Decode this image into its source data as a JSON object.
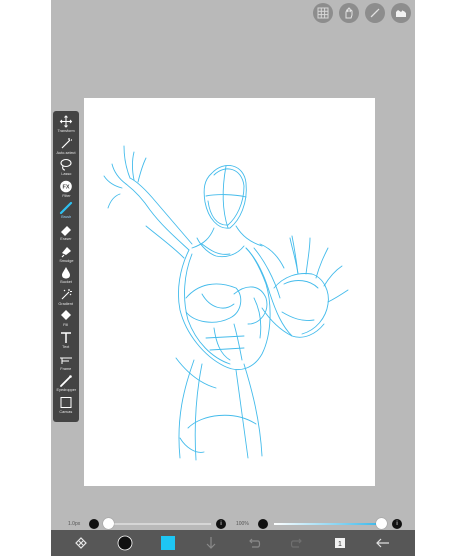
{
  "top_tools": [
    {
      "name": "layer-grid-icon"
    },
    {
      "name": "hand-icon"
    },
    {
      "name": "ruler-icon"
    },
    {
      "name": "material-icon"
    }
  ],
  "toolbar": {
    "tools": [
      {
        "name": "tool-transform",
        "icon": "move-icon",
        "label": "Transform"
      },
      {
        "name": "tool-auto-select",
        "icon": "magic-wand-icon",
        "label": "Auto-select"
      },
      {
        "name": "tool-lasso",
        "icon": "lasso-icon",
        "label": "Lasso"
      },
      {
        "name": "tool-filter",
        "icon": "fx-icon",
        "label": "Filter"
      },
      {
        "name": "tool-brush",
        "icon": "brush-icon",
        "label": "Brush"
      },
      {
        "name": "tool-eraser",
        "icon": "eraser-icon",
        "label": "Eraser"
      },
      {
        "name": "tool-smudge",
        "icon": "smudge-icon",
        "label": "Smudge"
      },
      {
        "name": "tool-bucket",
        "icon": "droplet-icon",
        "label": "Bucket"
      },
      {
        "name": "tool-gradient",
        "icon": "sparkle-wand-icon",
        "label": "Gradient"
      },
      {
        "name": "tool-fill",
        "icon": "fill-icon",
        "label": "Fill"
      },
      {
        "name": "tool-text",
        "icon": "text-icon",
        "label": "Text"
      },
      {
        "name": "tool-frame",
        "icon": "frame-icon",
        "label": "Frame"
      },
      {
        "name": "tool-eyedropper",
        "icon": "eyedropper-icon",
        "label": "Eyedropper"
      },
      {
        "name": "tool-canvas",
        "icon": "canvas-icon",
        "label": "Canvas"
      }
    ],
    "active_index": 4
  },
  "size_slider": {
    "label": "1.0px",
    "value": 0.0
  },
  "opacity_slider": {
    "label": "100%",
    "value": 1.0
  },
  "colors": {
    "current_color": "#1ec6f4",
    "stroke": "#3ab8ea",
    "toolbar_bg": "#444444",
    "app_bg": "#b9b9b9",
    "bottom_bar_bg": "#575757"
  },
  "bottom_bar": {
    "items": [
      {
        "name": "menu-icon"
      },
      {
        "name": "color-wheel-icon"
      },
      {
        "name": "current-color-swatch"
      },
      {
        "name": "download-arrow-icon"
      },
      {
        "name": "undo-icon"
      },
      {
        "name": "redo-icon"
      },
      {
        "name": "layers-icon",
        "badge": "1"
      },
      {
        "name": "back-arrow-icon"
      }
    ]
  }
}
